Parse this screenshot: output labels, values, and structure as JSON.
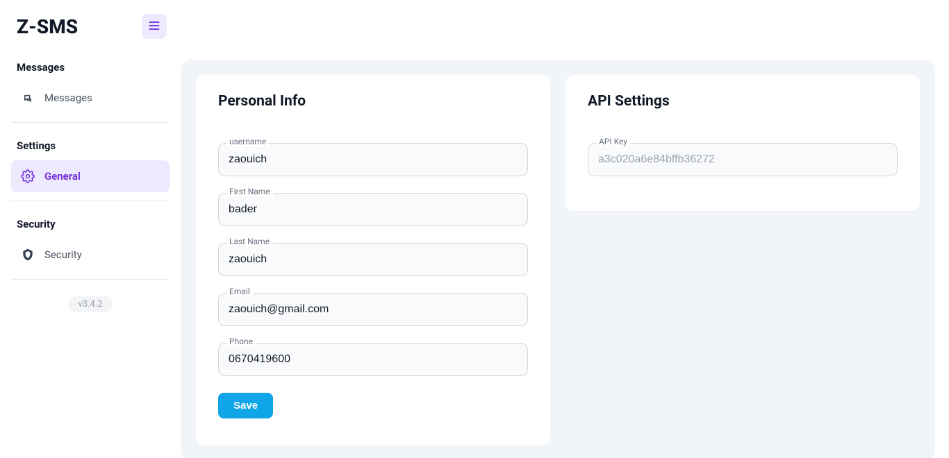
{
  "app": {
    "logo": "Z-SMS",
    "version": "v3.4.2"
  },
  "sidebar": {
    "sections": [
      {
        "title": "Messages",
        "items": [
          {
            "label": "Messages",
            "icon": "messages-icon"
          }
        ]
      },
      {
        "title": "Settings",
        "items": [
          {
            "label": "General",
            "icon": "gear-icon",
            "active": true
          }
        ]
      },
      {
        "title": "Security",
        "items": [
          {
            "label": "Security",
            "icon": "shield-icon"
          }
        ]
      }
    ]
  },
  "main": {
    "personal": {
      "title": "Personal Info",
      "fields": {
        "username": {
          "label": "username",
          "value": "zaouich"
        },
        "first_name": {
          "label": "First Name",
          "value": "bader"
        },
        "last_name": {
          "label": "Last Name",
          "value": "zaouich"
        },
        "email": {
          "label": "Email",
          "value": "zaouich@gmail.com"
        },
        "phone": {
          "label": "Phone",
          "value": "0670419600"
        }
      },
      "save_label": "Save"
    },
    "api": {
      "title": "API Settings",
      "fields": {
        "api_key": {
          "label": "API Key",
          "value": "a3c020a6e84bffb36272"
        }
      }
    }
  },
  "colors": {
    "accent": "#6d28d9",
    "surface": "#f1f5f9",
    "primary_btn": "#0ea5e9"
  }
}
